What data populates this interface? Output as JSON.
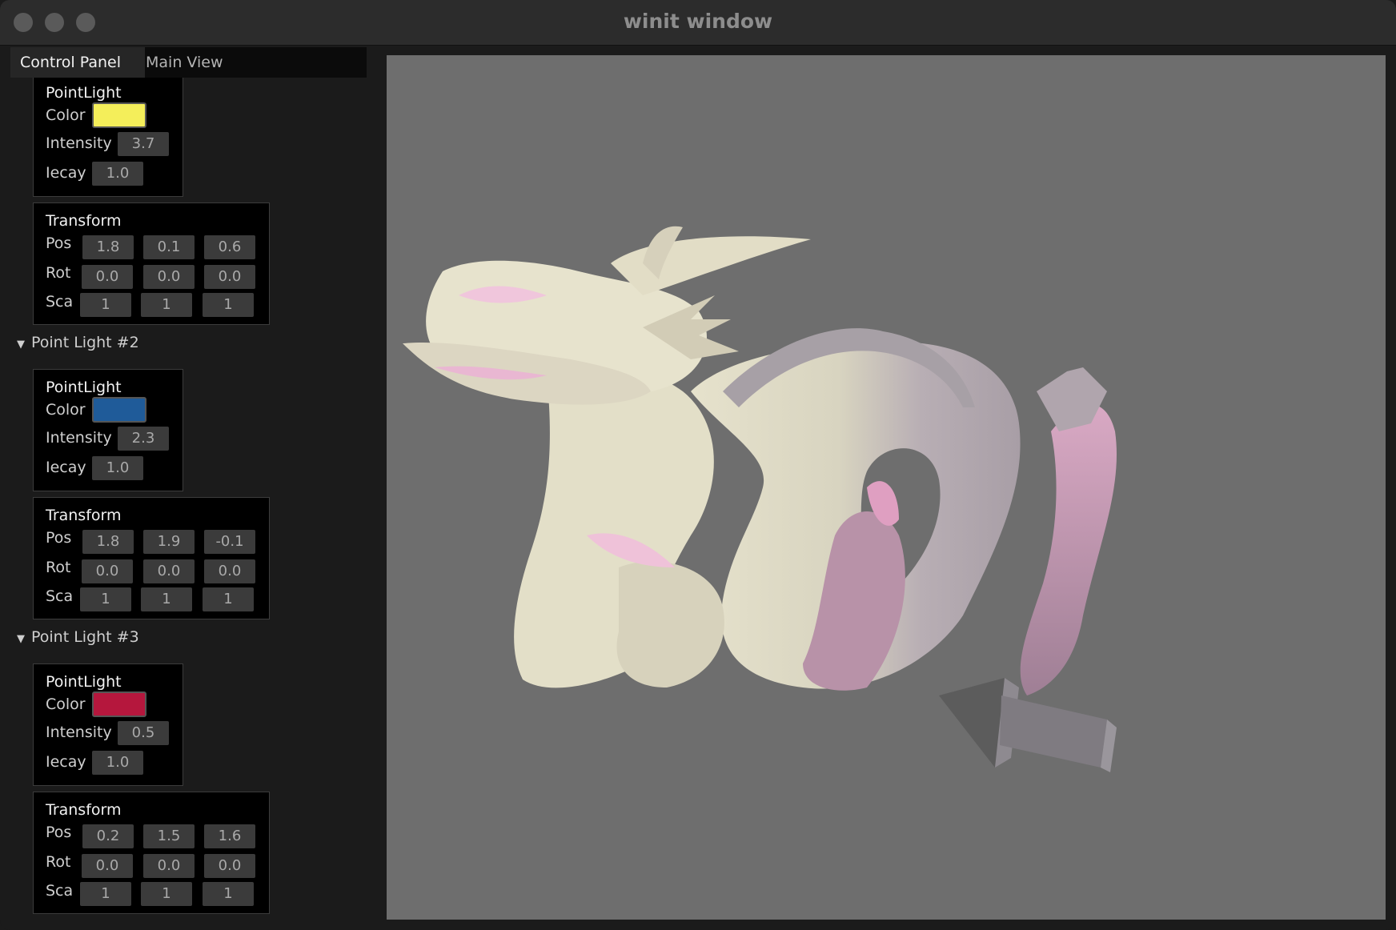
{
  "window": {
    "title": "winit window"
  },
  "tabs": [
    {
      "label": "Control Panel",
      "active": true
    },
    {
      "label": "Main View",
      "active": false
    }
  ],
  "labels": {
    "point_light": "PointLight",
    "color": "Color",
    "intensity": "Intensity",
    "decay": "Iecay",
    "transform": "Transform",
    "pos": "Pos",
    "rot": "Rot",
    "sca": "Sca"
  },
  "lights": [
    {
      "color": "#f4ee5a",
      "intensity": "3.7",
      "decay": "1.0",
      "pos": [
        "1.8",
        "0.1",
        "0.6"
      ],
      "rot": [
        "0.0",
        "0.0",
        "0.0"
      ],
      "sca": [
        "1",
        "1",
        "1"
      ]
    },
    {
      "header": "Point Light #2",
      "color": "#1f5b99",
      "intensity": "2.3",
      "decay": "1.0",
      "pos": [
        "1.8",
        "1.9",
        "-0.1"
      ],
      "rot": [
        "0.0",
        "0.0",
        "0.0"
      ],
      "sca": [
        "1",
        "1",
        "1"
      ]
    },
    {
      "header": "Point Light #3",
      "color": "#b5173d",
      "intensity": "0.5",
      "decay": "1.0",
      "pos": [
        "0.2",
        "1.5",
        "1.6"
      ],
      "rot": [
        "0.0",
        "0.0",
        "0.0"
      ],
      "sca": [
        "1",
        "1",
        "1"
      ]
    }
  ],
  "viewport": {
    "background": "#6e6e6e",
    "model": "dragon-with-box"
  }
}
